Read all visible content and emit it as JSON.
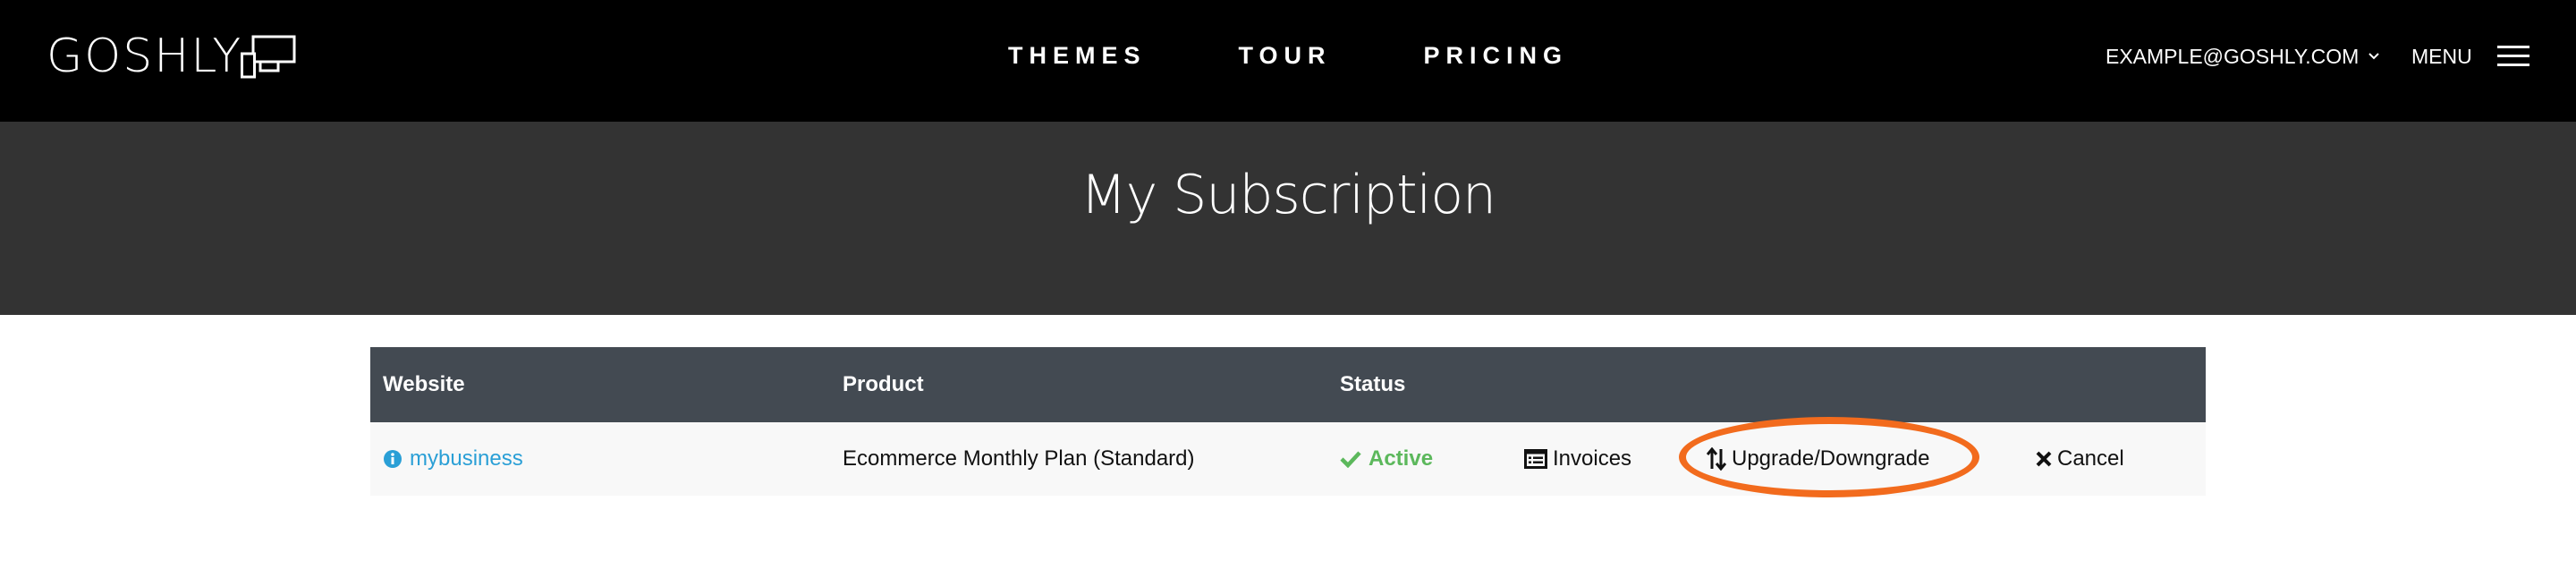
{
  "brand": {
    "name": "GOSHLY",
    "logo_icon": "devices-icon"
  },
  "nav": {
    "links": [
      "THEMES",
      "TOUR",
      "PRICING"
    ],
    "account_email": "EXAMPLE@GOSHLY.COM",
    "account_icon": "chevron-down-icon",
    "menu_label": "MENU",
    "menu_icon": "hamburger-icon"
  },
  "page": {
    "title": "My Subscription"
  },
  "table": {
    "headers": {
      "website": "Website",
      "product": "Product",
      "status": "Status"
    },
    "rows": [
      {
        "website": "mybusiness",
        "website_icon": "info-circle-icon",
        "product": "Ecommerce Monthly Plan (Standard)",
        "status": "Active",
        "status_icon": "check-icon",
        "actions": {
          "invoices": "Invoices",
          "invoices_icon": "list-alt-icon",
          "upgrade": "Upgrade/Downgrade",
          "upgrade_icon": "sort-arrows-icon",
          "cancel": "Cancel",
          "cancel_icon": "times-icon"
        }
      }
    ]
  },
  "colors": {
    "topbar": "#000000",
    "title_band": "#333333",
    "table_header": "#434a52",
    "row_bg": "#f8f8f8",
    "link": "#2a9fd6",
    "active": "#5cb85c",
    "highlight": "#f26b1d"
  }
}
